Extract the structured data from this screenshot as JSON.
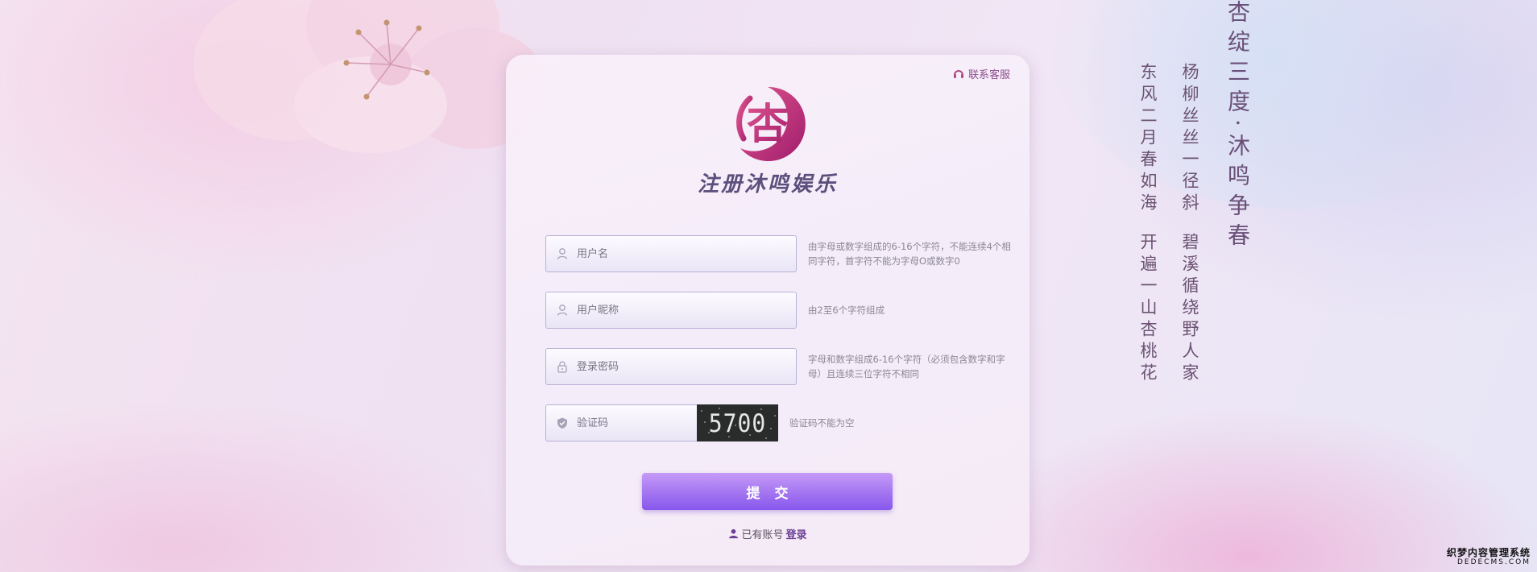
{
  "contact": {
    "label": "联系客服",
    "icon": "headset-icon"
  },
  "logo": {
    "char": "杏",
    "title": "注册沐鸣娱乐",
    "colors": [
      "#e0568f",
      "#a01c6c"
    ]
  },
  "form": {
    "username": {
      "placeholder": "用户名",
      "icon": "user-icon",
      "hint": "由字母或数字组成的6-16个字符，不能连续4个相同字符，首字符不能为字母O或数字0"
    },
    "nickname": {
      "placeholder": "用户昵称",
      "icon": "user-icon",
      "hint": "由2至6个字符组成"
    },
    "password": {
      "placeholder": "登录密码",
      "icon": "lock-icon",
      "hint": "字母和数字组成6-16个字符（必须包含数字和字母）且连续三位字符不相同"
    },
    "captcha": {
      "placeholder": "验证码",
      "icon": "shield-icon",
      "image_text": "5700",
      "hint": "验证码不能为空"
    },
    "submit_label": "提交"
  },
  "login": {
    "prefix": "已有账号",
    "link_label": "登录"
  },
  "poem": {
    "title": "杏绽三度·沐鸣争春",
    "line1a": "杨柳丝丝一径斜",
    "line1b": "碧溪循绕野人家",
    "line2a": "东风二月春如海",
    "line2b": "开遍一山杏桃花"
  },
  "watermark": {
    "line1": "织梦内容管理系统",
    "line2": "DEDECMS.COM"
  },
  "colors": {
    "accent": "#8757ec",
    "accent_light": "#c59af6",
    "brand": "#c2317a",
    "text_hint": "#8c8697"
  }
}
